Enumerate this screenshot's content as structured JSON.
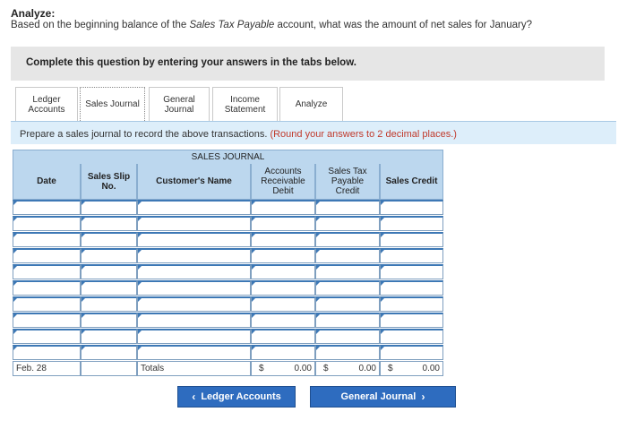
{
  "header": {
    "title": "Analyze:",
    "question_before": "Based on the beginning balance of the ",
    "question_italic": "Sales Tax Payable",
    "question_after": " account, what was the amount of net sales for January?"
  },
  "instruction_bar": "Complete this question by entering your answers in the tabs below.",
  "tabs": [
    {
      "line1": "Ledger",
      "line2": "Accounts"
    },
    {
      "line1": "Sales Journal",
      "line2": ""
    },
    {
      "line1": "General",
      "line2": "Journal"
    },
    {
      "line1": "Income",
      "line2": "Statement"
    },
    {
      "line1": "Analyze",
      "line2": ""
    }
  ],
  "instructions": {
    "text": "Prepare a sales journal to record the above transactions.",
    "note": "(Round your answers to 2 decimal places.)"
  },
  "journal": {
    "title": "SALES JOURNAL",
    "columns": [
      {
        "line1": "Date",
        "line2": "",
        "line3": ""
      },
      {
        "line1": "Sales Slip",
        "line2": "No.",
        "line3": ""
      },
      {
        "line1": "Customer's Name",
        "line2": "",
        "line3": ""
      },
      {
        "line1": "Accounts",
        "line2": "Receivable",
        "line3": "Debit"
      },
      {
        "line1": "Sales Tax",
        "line2": "Payable",
        "line3": "Credit"
      },
      {
        "line1": "Sales Credit",
        "line2": "",
        "line3": ""
      }
    ],
    "total_row": {
      "date": "Feb. 28",
      "customer": "Totals",
      "ar_currency": "$",
      "ar_amount": "0.00",
      "stp_currency": "$",
      "stp_amount": "0.00",
      "sales_currency": "$",
      "sales_amount": "0.00"
    }
  },
  "nav": {
    "prev_label": "Ledger Accounts",
    "next_label": "General Journal",
    "prev_arrow": "‹",
    "next_arrow": "›"
  },
  "colors": {
    "accent": "#2e6cbf",
    "header_fill": "#bcd7ee",
    "instruction_fill": "#ddeefa",
    "note_red": "#c0392b"
  }
}
